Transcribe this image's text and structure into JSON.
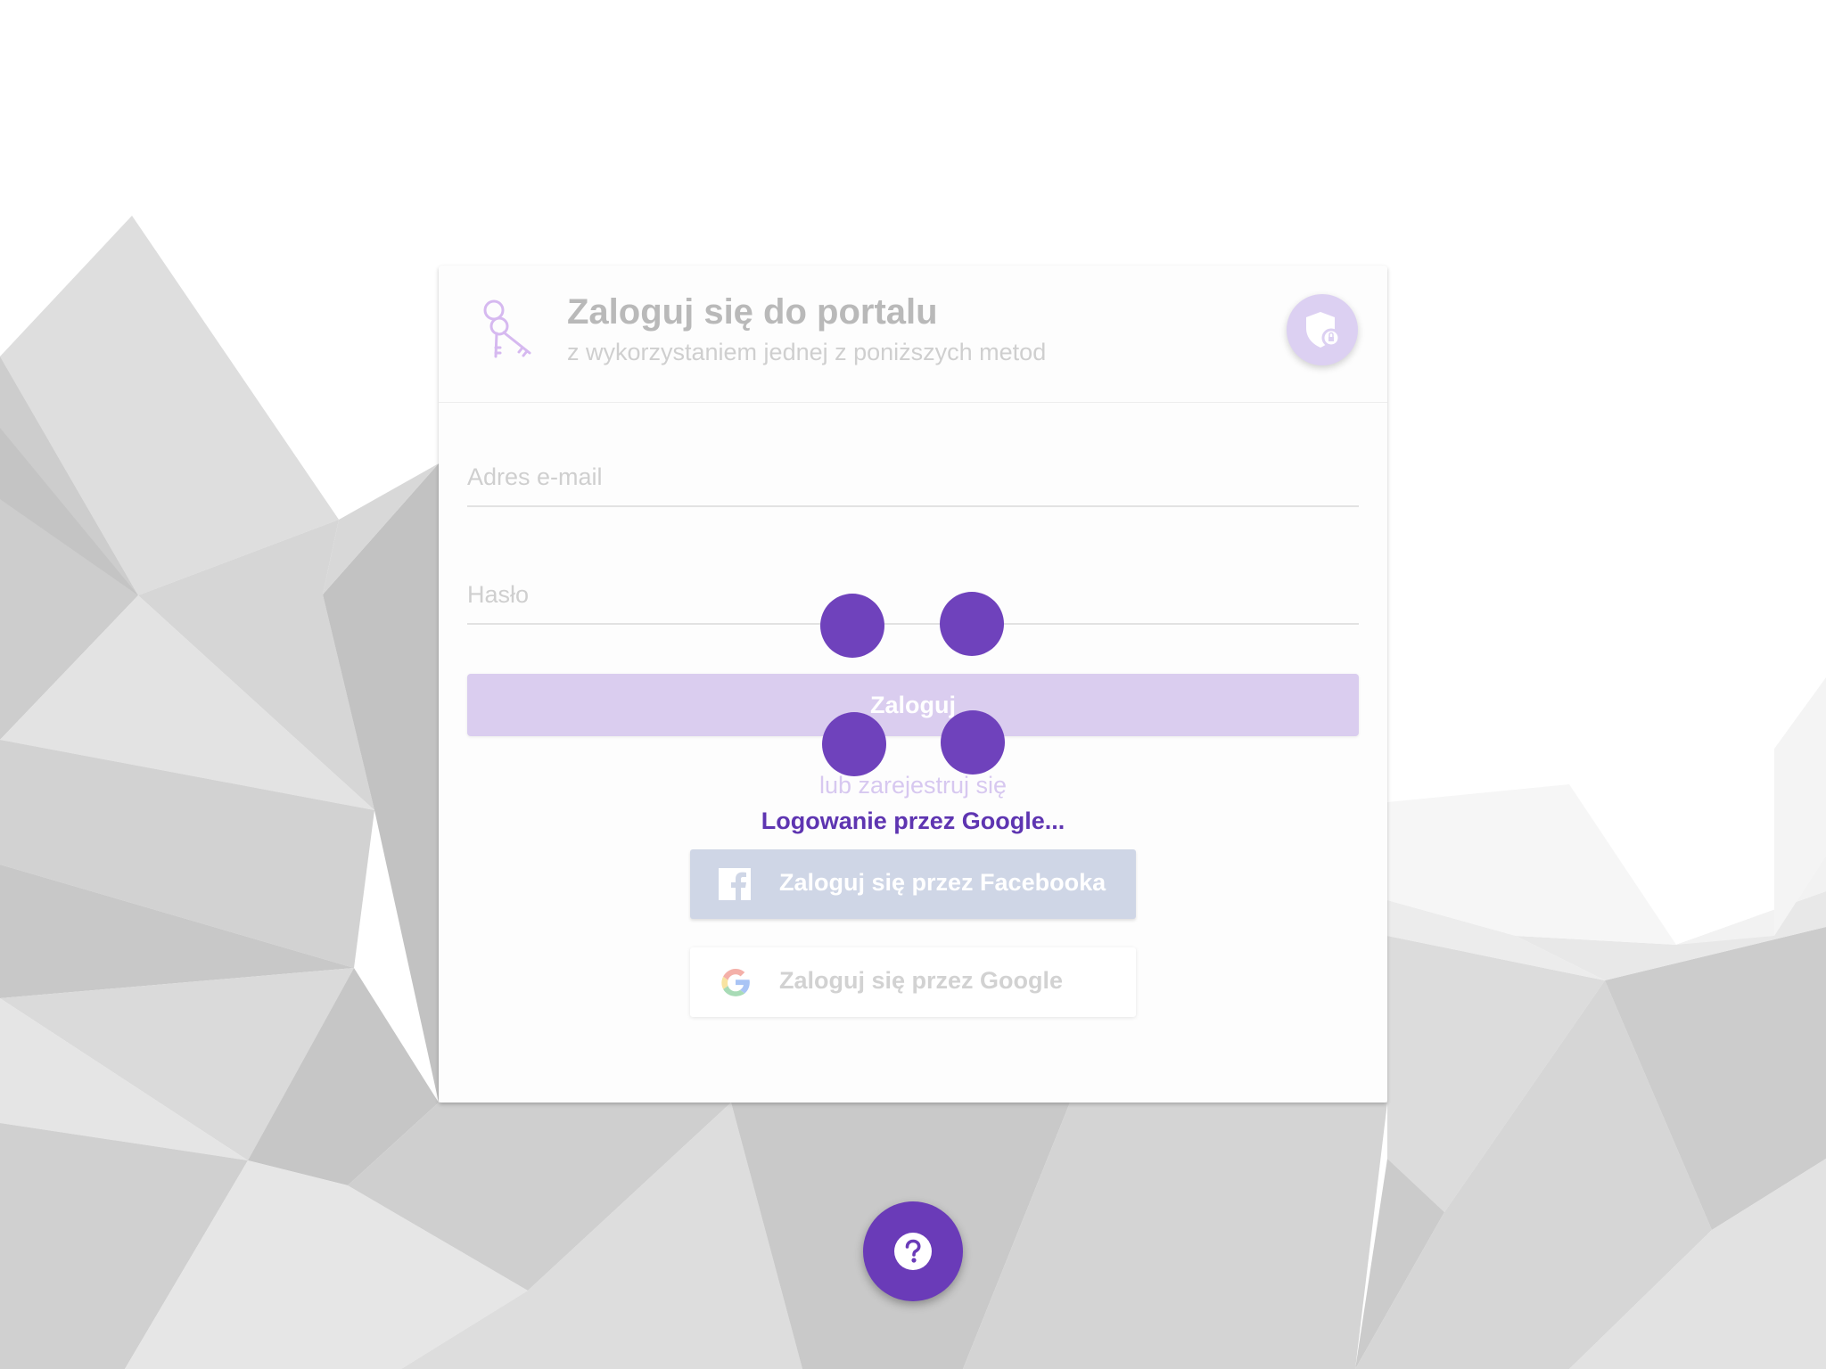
{
  "login": {
    "title": "Zaloguj się do portalu",
    "subtitle": "z wykorzystaniem jednej z poniższych metod",
    "email_placeholder": "Adres e-mail",
    "password_placeholder": "Hasło",
    "submit_label": "Zaloguj",
    "register_link": "lub zarejestruj się",
    "status_message": "Logowanie przez Google...",
    "facebook_label": "Zaloguj się przez Facebooka",
    "google_label": "Zaloguj się przez Google"
  },
  "icons": {
    "header": "keys-icon",
    "privacy": "shield-icon",
    "facebook": "facebook-icon",
    "google": "google-icon",
    "help": "question-icon"
  },
  "colors": {
    "accent": "#6a3bb8",
    "accent_light": "#dacdef",
    "facebook_disabled": "#cfd6e6",
    "status_text": "#5e35b1"
  }
}
